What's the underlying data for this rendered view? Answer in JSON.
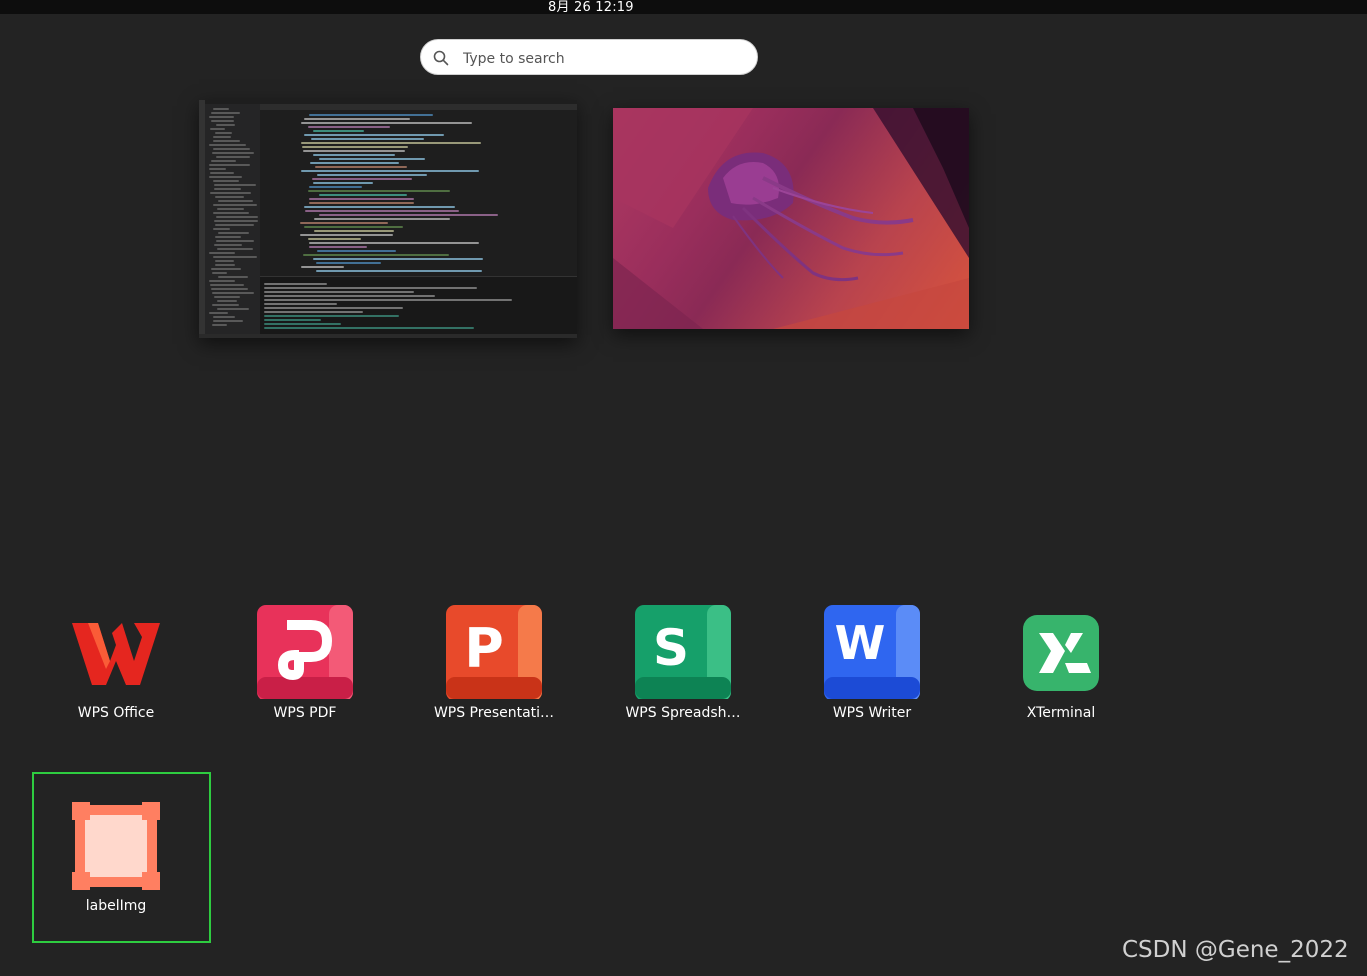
{
  "topbar": {
    "clock": "8月 26  12:19"
  },
  "search": {
    "placeholder": "Type to search"
  },
  "apps": [
    {
      "label": "WPS Office",
      "icon": "wps-office-icon",
      "color": "#e5261f"
    },
    {
      "label": "WPS PDF",
      "icon": "wps-pdf-icon",
      "color": "#e8325a"
    },
    {
      "label": "WPS Presentati…",
      "icon": "wps-presentation-icon",
      "color": "#e84a2b"
    },
    {
      "label": "WPS Spreadsh…",
      "icon": "wps-spreadsheet-icon",
      "color": "#16a06a"
    },
    {
      "label": "WPS Writer",
      "icon": "wps-writer-icon",
      "color": "#2f66f0"
    },
    {
      "label": "XTerminal",
      "icon": "xterminal-icon",
      "color": "#37b46c"
    },
    {
      "label": "labelImg",
      "icon": "labelimg-icon",
      "color": "#ff7f61"
    }
  ],
  "watermark": "CSDN @Gene_2022"
}
